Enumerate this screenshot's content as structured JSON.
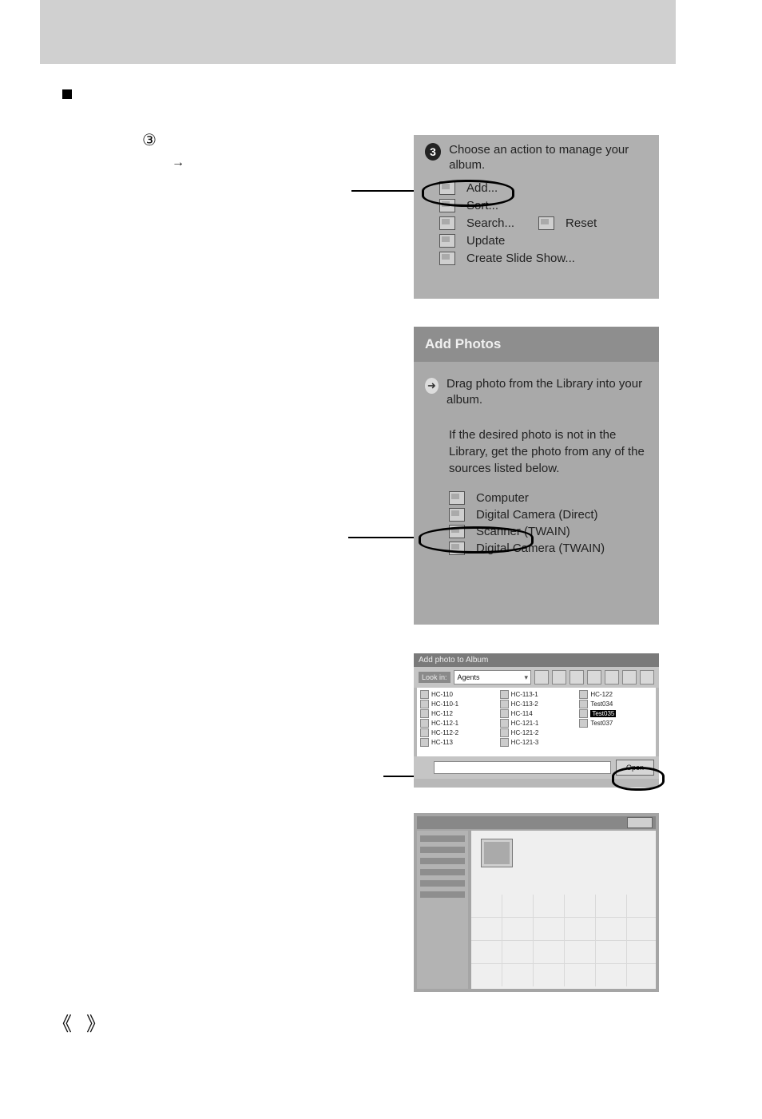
{
  "panel1": {
    "badge": "3",
    "title": "Choose an action to manage your album.",
    "items": [
      "Add...",
      "Sort...",
      "Search...",
      "Reset",
      "Update",
      "Create Slide Show..."
    ]
  },
  "panel2": {
    "header": "Add Photos",
    "lead": "Drag photo from the Library into your album.",
    "info": "If the desired photo is not in the Library, get the photo from any of the sources listed below.",
    "sources": [
      "Computer",
      "Digital Camera (Direct)",
      "Scanner (TWAIN)",
      "Digital Camera (TWAIN)"
    ]
  },
  "panel3": {
    "title": "Add photo to Album",
    "lookin_label": "Look in:",
    "folder": "Agents",
    "files_col1": [
      "HC-110",
      "HC-110-1",
      "HC-112",
      "HC-112-1",
      "HC-112-2",
      "HC-113"
    ],
    "files_col2": [
      "HC-113-1",
      "HC-113-2",
      "HC-114",
      "HC-121-1",
      "HC-121-2",
      "HC-121-3"
    ],
    "files_col3": [
      "HC-122",
      "Test034",
      "Test035",
      "Test037"
    ],
    "selected": "Test035",
    "open_label": "Open"
  },
  "symbols": {
    "circled_three": "③",
    "right_arrow": "→",
    "angle_left": "《",
    "angle_right": "》"
  }
}
